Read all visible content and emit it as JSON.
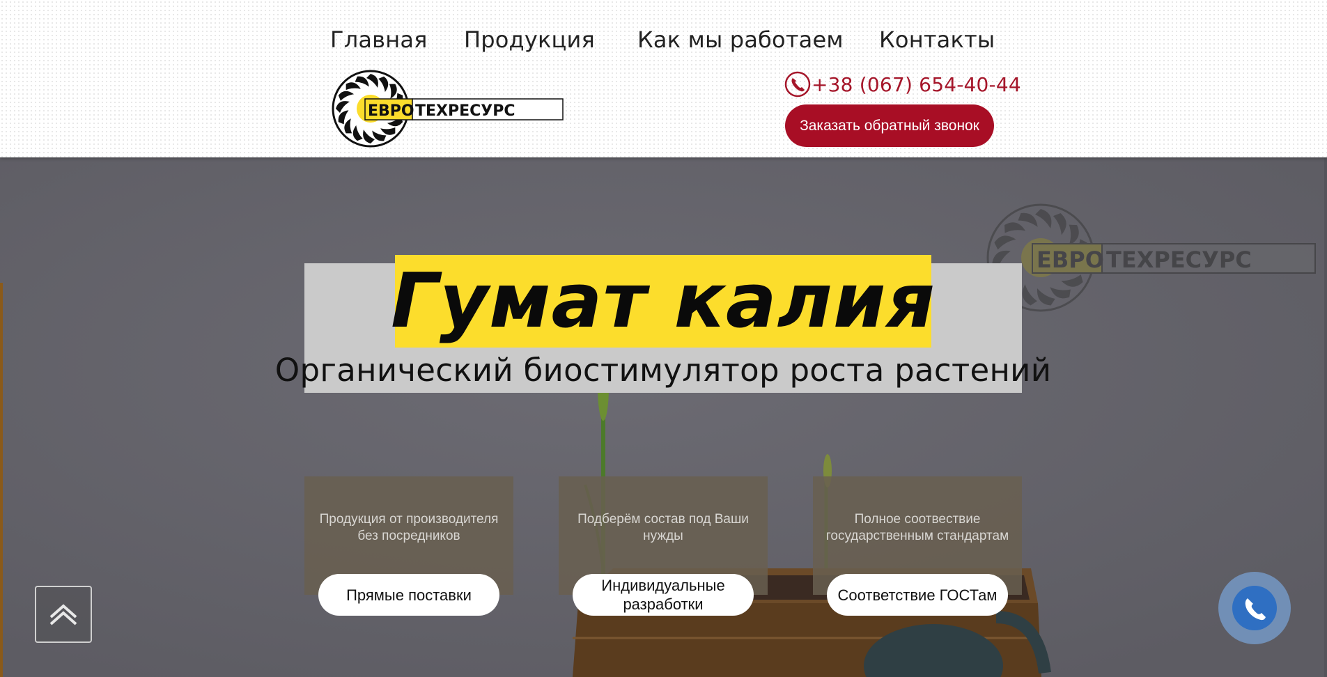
{
  "nav": {
    "items": [
      {
        "label": "Главная"
      },
      {
        "label": "Продукция"
      },
      {
        "label": "Как мы работаем"
      },
      {
        "label": "Контакты"
      }
    ]
  },
  "logo": {
    "text_part1": "ЕВРО",
    "text_part2": "ТЕХРЕСУРС",
    "colors": {
      "yellow": "#fcdd2c",
      "black": "#111111"
    }
  },
  "contact": {
    "phone_icon": "phone-icon",
    "phone_number": "+38 (067) 654-40-44",
    "callback_button": "Заказать обратный звонок",
    "accent_color": "#a80e25"
  },
  "hero": {
    "title": "Гумат калия",
    "subtitle": "Органический биостимулятор роста растений",
    "title_bg_color": "#fcdd2c",
    "features": [
      {
        "text": "Продукция от производителя без посредников",
        "button": "Прямые поставки"
      },
      {
        "text": "Подберём состав под Ваши нужды",
        "button": "Индивидуальные разработки"
      },
      {
        "text": "Полное соотвествие государственным стандартам",
        "button": "Соответствие ГОСТам"
      }
    ]
  },
  "widgets": {
    "scroll_top_icon": "chevron-up-icon",
    "call_icon": "phone-icon"
  }
}
